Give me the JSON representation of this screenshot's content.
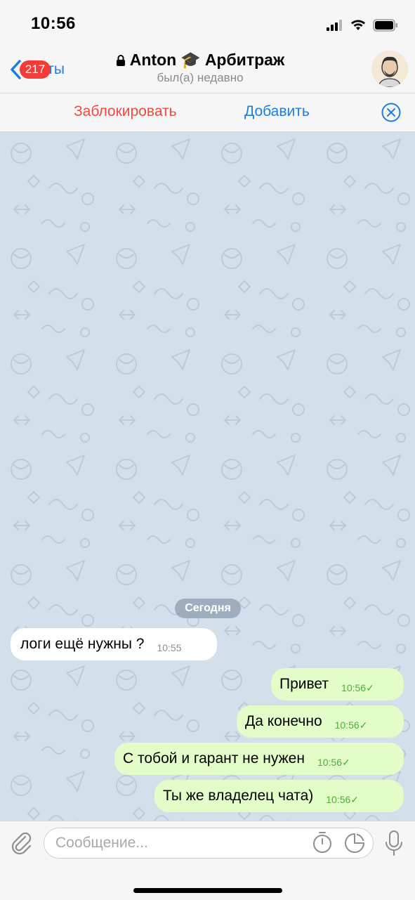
{
  "status_bar": {
    "time": "10:56"
  },
  "nav": {
    "back_label": "Чаты",
    "unread_badge": "217",
    "contact_name": "Anton",
    "emoji": "🎓",
    "contact_suffix": "Арбитраж",
    "last_seen": "был(а) недавно"
  },
  "actions": {
    "block_label": "Заблокировать",
    "add_label": "Добавить"
  },
  "chat": {
    "date_separator": "Сегодня",
    "incoming": [
      {
        "text": "логи ещё нужны ?",
        "time": "10:55"
      }
    ],
    "outgoing": [
      {
        "text": "Привет",
        "time": "10:56",
        "status": "✓"
      },
      {
        "text": "Да конечно",
        "time": "10:56",
        "status": "✓"
      },
      {
        "text": "С тобой и гарант не нужен",
        "time": "10:56",
        "status": "✓"
      },
      {
        "text": "Ты же владелец чата)",
        "time": "10:56",
        "status": "✓"
      }
    ]
  },
  "input": {
    "placeholder": "Сообщение..."
  },
  "colors": {
    "accent": "#1c7fe0",
    "danger": "#f04a3f",
    "chat_bg": "#d3e0ec",
    "outgoing_bubble": "#e2fdc7",
    "badge": "#f23c35"
  },
  "icons": [
    "signal-icon",
    "wifi-icon",
    "battery-icon",
    "back-chevron-icon",
    "lock-icon",
    "close-icon",
    "attach-icon",
    "timer-icon",
    "sticker-icon",
    "microphone-icon"
  ]
}
